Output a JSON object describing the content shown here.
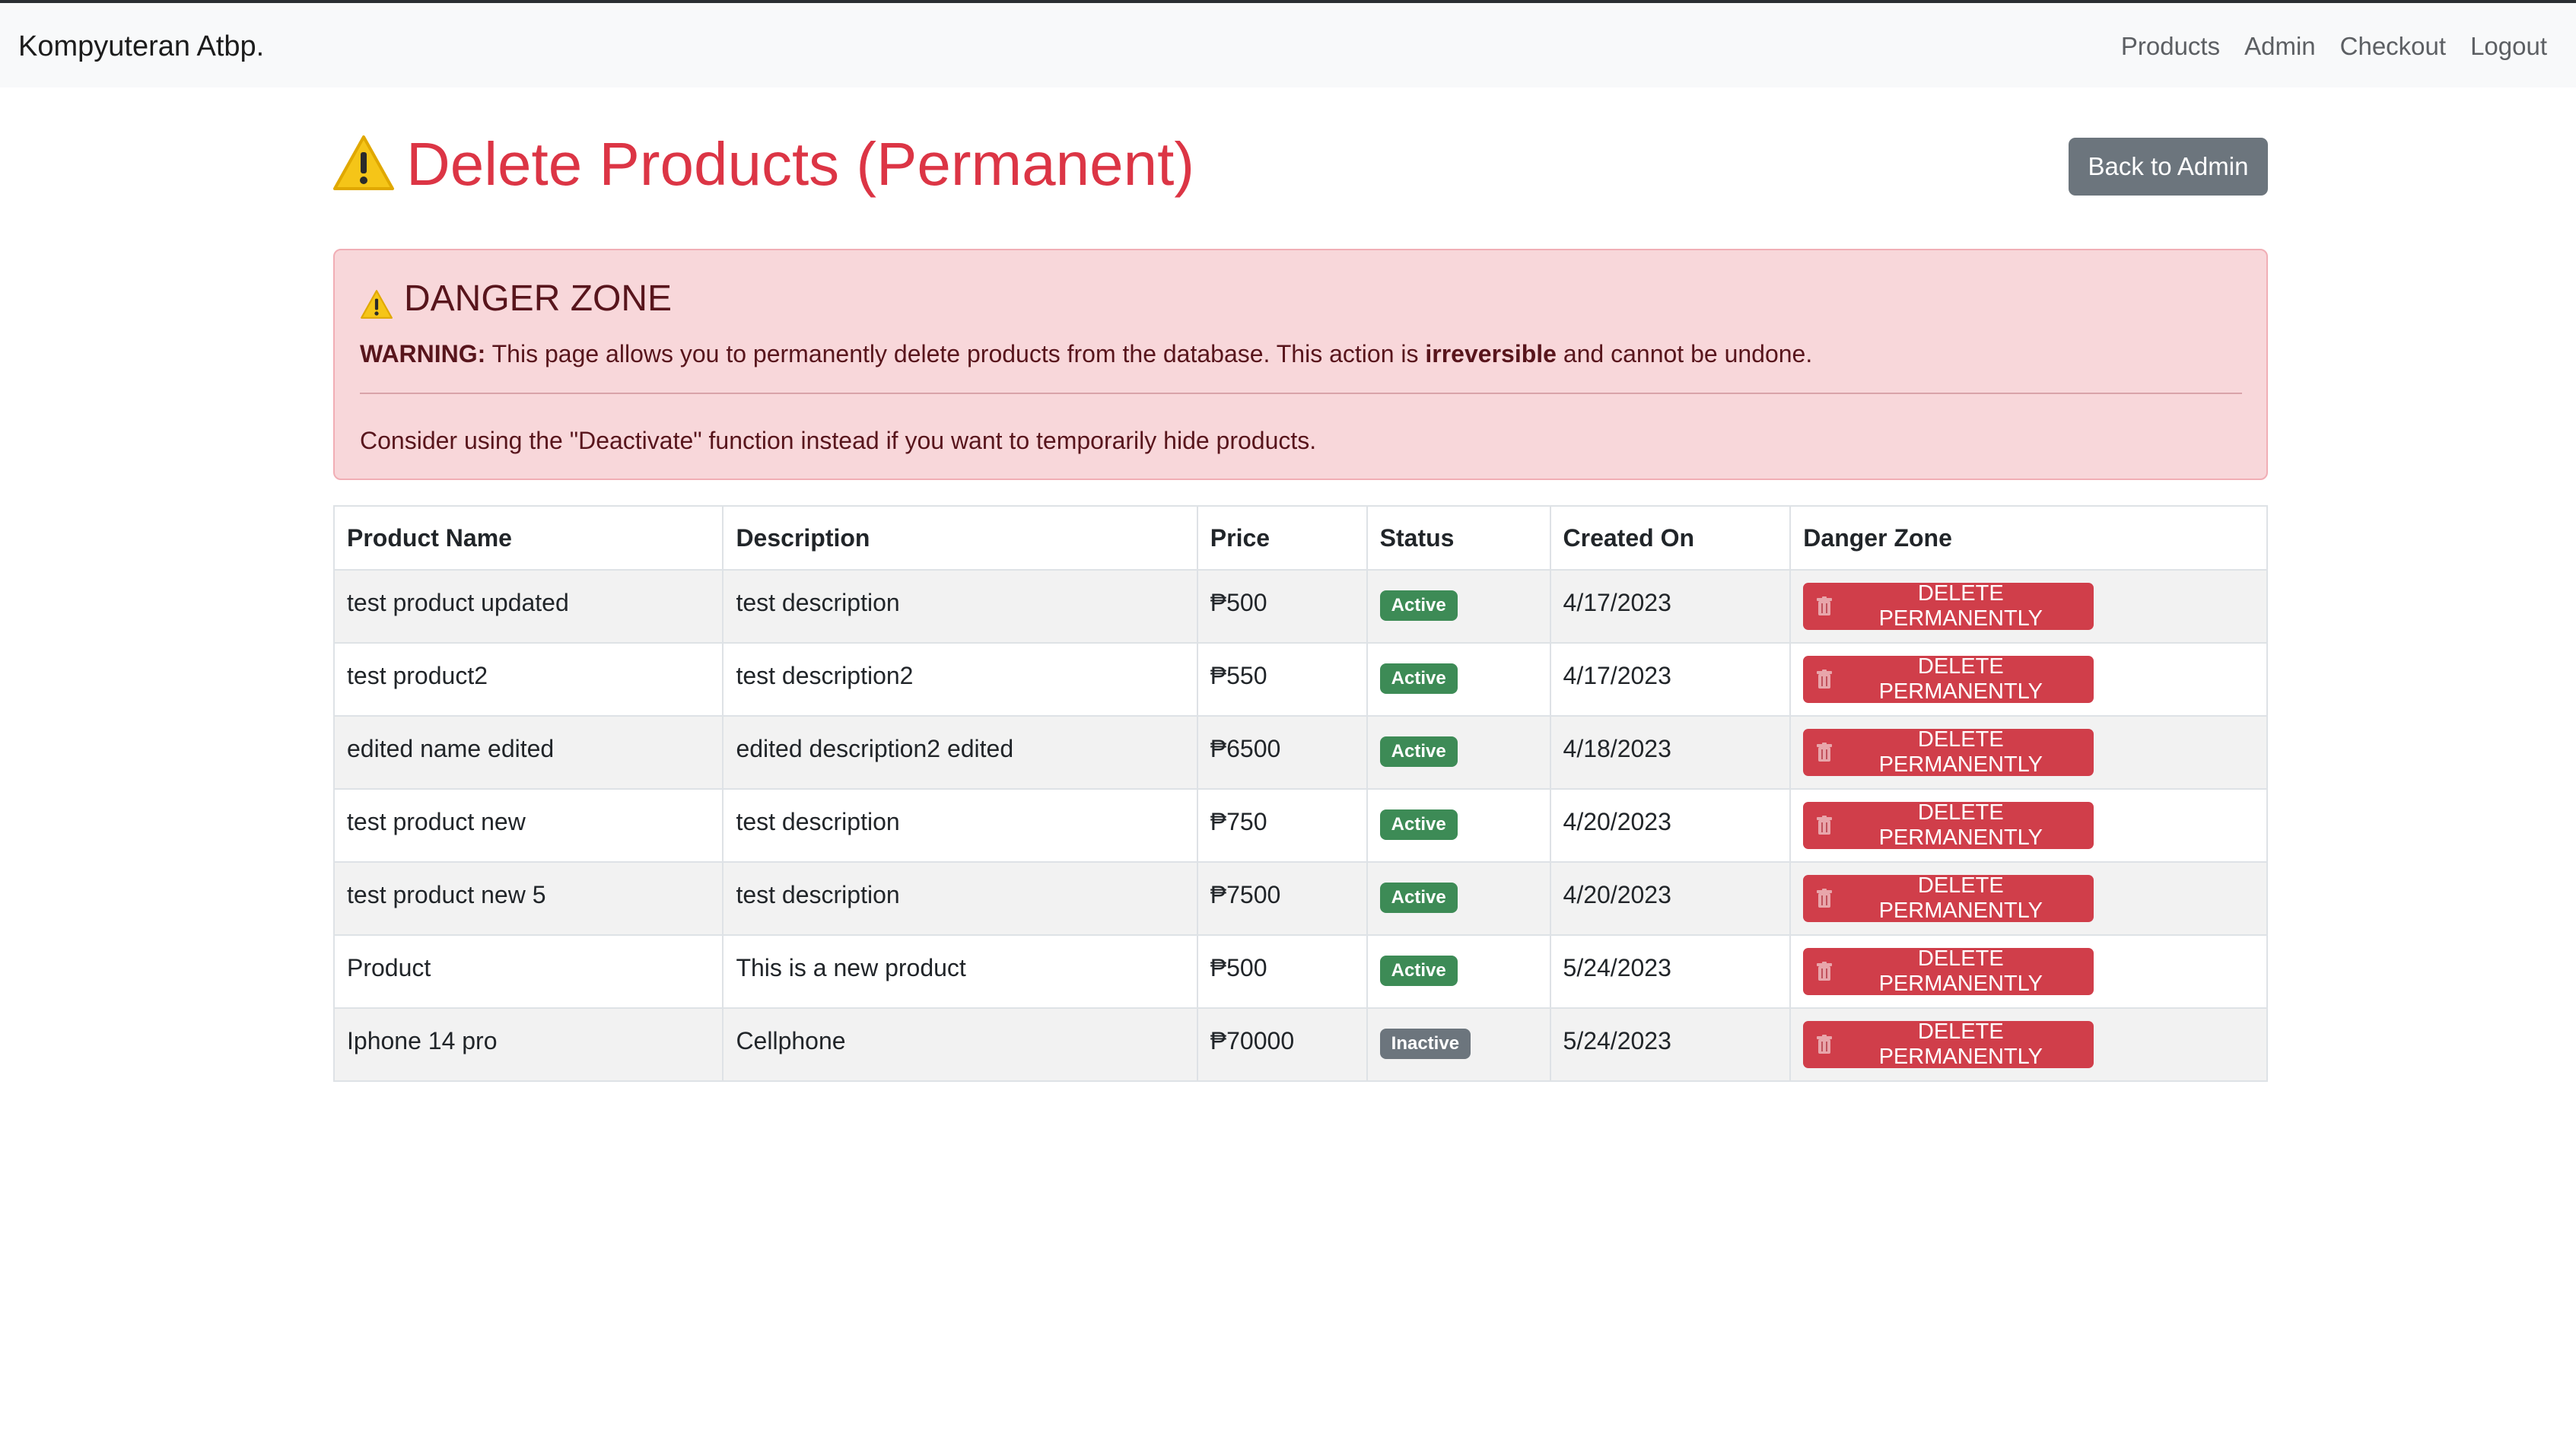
{
  "navbar": {
    "brand": "Kompyuteran Atbp.",
    "links": [
      "Products",
      "Admin",
      "Checkout",
      "Logout"
    ]
  },
  "page": {
    "title": "Delete Products (Permanent)",
    "back_button": "Back to Admin",
    "title_icon": "warning-icon"
  },
  "alert": {
    "heading": "DANGER ZONE",
    "warning_label": "WARNING:",
    "warning_text_before": " This page allows you to permanently delete products from the database. This action is ",
    "warning_bold": "irreversible",
    "warning_text_after": " and cannot be undone.",
    "suggestion": "Consider using the \"Deactivate\" function instead if you want to temporarily hide products."
  },
  "table": {
    "headers": [
      "Product Name",
      "Description",
      "Price",
      "Status",
      "Created On",
      "Danger Zone"
    ],
    "delete_label": "DELETE PERMANENTLY",
    "rows": [
      {
        "name": "test product updated",
        "description": "test description",
        "price": "₱500",
        "status": "Active",
        "created": "4/17/2023"
      },
      {
        "name": "test product2",
        "description": "test description2",
        "price": "₱550",
        "status": "Active",
        "created": "4/17/2023"
      },
      {
        "name": "edited name edited",
        "description": "edited description2 edited",
        "price": "₱6500",
        "status": "Active",
        "created": "4/18/2023"
      },
      {
        "name": "test product new",
        "description": "test description",
        "price": "₱750",
        "status": "Active",
        "created": "4/20/2023"
      },
      {
        "name": "test product new 5",
        "description": "test description",
        "price": "₱7500",
        "status": "Active",
        "created": "4/20/2023"
      },
      {
        "name": "Product",
        "description": "This is a new product",
        "price": "₱500",
        "status": "Active",
        "created": "5/24/2023"
      },
      {
        "name": "Iphone 14 pro",
        "description": "Cellphone",
        "price": "₱70000",
        "status": "Inactive",
        "created": "5/24/2023"
      }
    ]
  },
  "colors": {
    "danger": "#dc3545",
    "alert_bg": "#f8d7da",
    "active_badge": "#3d8b56",
    "inactive_badge": "#6c757d",
    "secondary_button": "#6c757d"
  }
}
